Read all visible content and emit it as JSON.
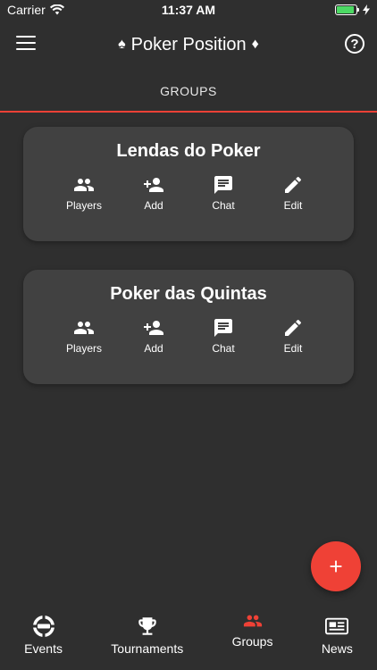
{
  "status": {
    "carrier": "Carrier",
    "time": "11:37 AM",
    "battery_level": 0.9
  },
  "header": {
    "title": "Poker Position",
    "left_suit": "♠",
    "right_suit": "♦",
    "help_symbol": "?"
  },
  "tabs": {
    "active": "GROUPS"
  },
  "groups": [
    {
      "name": "Lendas do Poker",
      "actions": {
        "players": "Players",
        "add": "Add",
        "chat": "Chat",
        "edit": "Edit"
      }
    },
    {
      "name": "Poker das Quintas",
      "actions": {
        "players": "Players",
        "add": "Add",
        "chat": "Chat",
        "edit": "Edit"
      }
    }
  ],
  "bottom_nav": {
    "events": "Events",
    "tournaments": "Tournaments",
    "groups": "Groups",
    "news": "News",
    "active": "Groups"
  },
  "colors": {
    "background": "#2f2f2f",
    "card": "#414141",
    "accent": "#ef4136",
    "battery": "#4cd964"
  }
}
